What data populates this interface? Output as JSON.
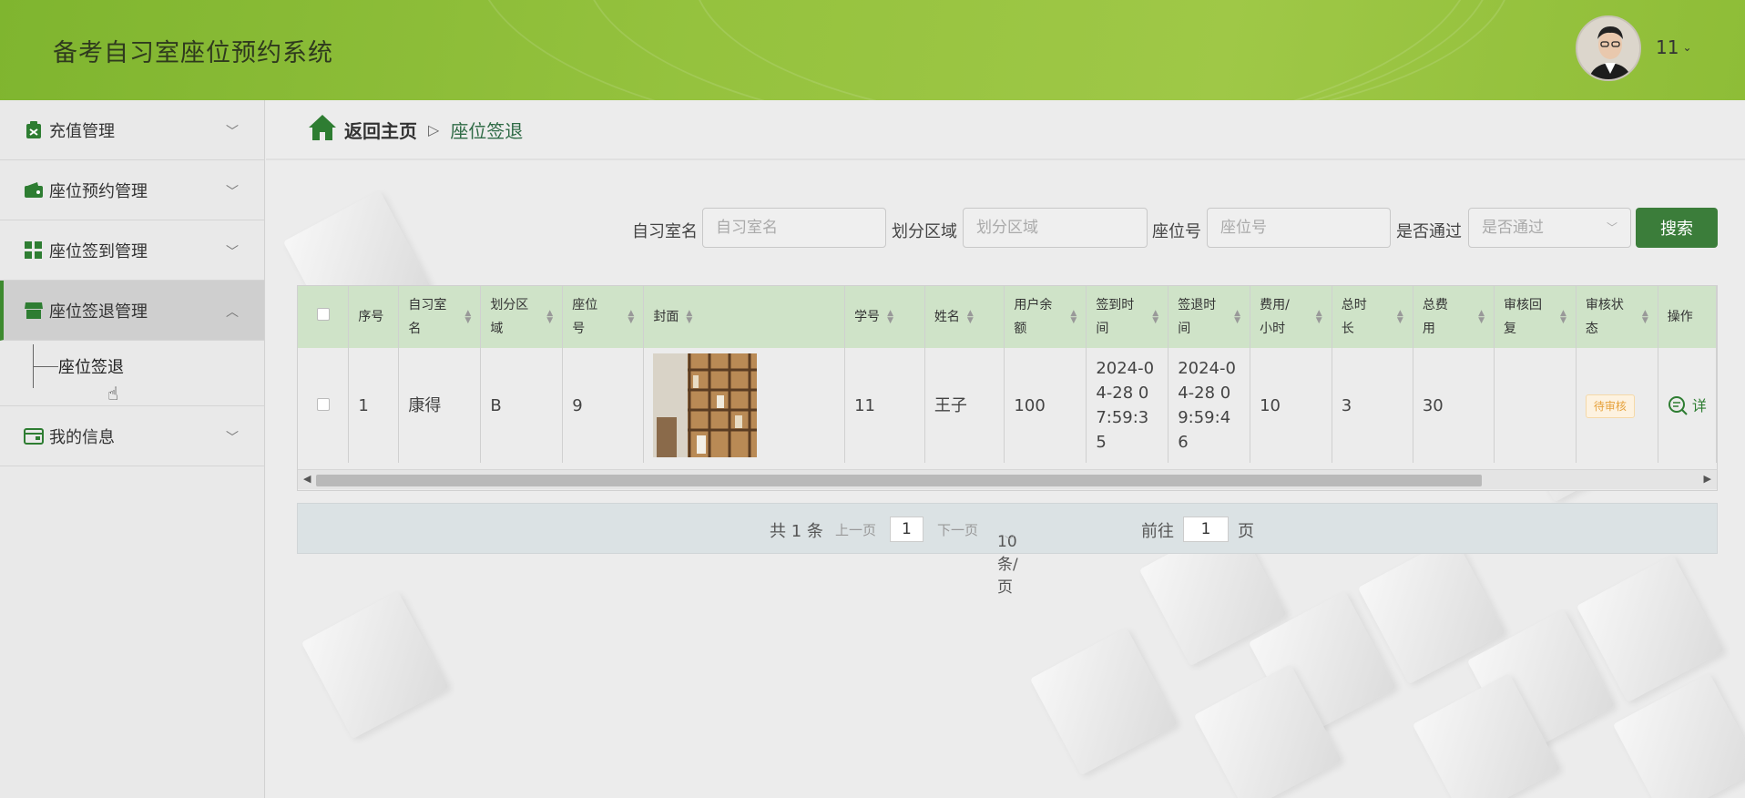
{
  "app": {
    "title": "备考自习室座位预约系统",
    "user_name": "11"
  },
  "sidebar": {
    "items": [
      {
        "label": "充值管理"
      },
      {
        "label": "座位预约管理"
      },
      {
        "label": "座位签到管理"
      },
      {
        "label": "座位签退管理"
      },
      {
        "label": "我的信息"
      }
    ],
    "submenu_item": "座位签退"
  },
  "breadcrumb": {
    "home": "返回主页",
    "current": "座位签退"
  },
  "search": {
    "room_label": "自习室名",
    "room_placeholder": "自习室名",
    "area_label": "划分区域",
    "area_placeholder": "划分区域",
    "seat_label": "座位号",
    "seat_placeholder": "座位号",
    "pass_label": "是否通过",
    "pass_placeholder": "是否通过",
    "button": "搜索"
  },
  "table": {
    "headers": [
      "序号",
      "自习室名",
      "划分区域",
      "座位号",
      "封面",
      "学号",
      "姓名",
      "用户余额",
      "签到时间",
      "签退时间",
      "费用/小时",
      "总时长",
      "总费用",
      "审核回复",
      "审核状态",
      "操作"
    ],
    "rows": [
      {
        "index": "1",
        "room": "康得",
        "area": "B",
        "seat": "9",
        "student_id": "11",
        "name": "王子",
        "balance": "100",
        "checkin": "2024-04-28 07:59:35",
        "checkout": "2024-04-28 09:59:46",
        "fee": "10",
        "duration": "3",
        "total": "30",
        "reply": "",
        "status": "待审核",
        "action": "详"
      }
    ]
  },
  "pager": {
    "total": "共 1 条",
    "prev": "上一页",
    "page": "1",
    "next": "下一页",
    "size": "10条/页",
    "goto": "前往",
    "goto_page": "1",
    "page_unit": "页"
  }
}
